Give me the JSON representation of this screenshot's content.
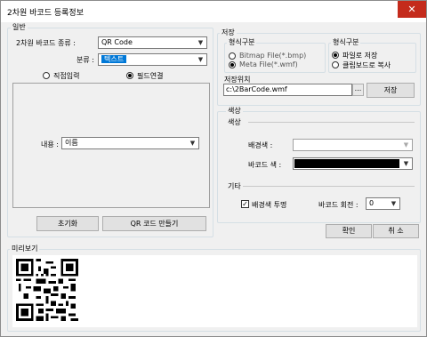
{
  "window": {
    "title": "2차원 바코드 등록정보",
    "close_glyph": "✕"
  },
  "general": {
    "group_label": "일반",
    "type_label": "2차원 바코드 종류 :",
    "type_value": "QR Code",
    "category_label": "분류 :",
    "category_value": "텍스트",
    "radio_direct": "직접입력",
    "radio_field": "필드연결",
    "content_label": "내용 :",
    "content_value": "이름",
    "reset_button": "초기화",
    "make_button": "QR 코드 만들기"
  },
  "save": {
    "group_label": "저장",
    "format_label": "형식구분",
    "bmp_option": "Bitmap File(*.bmp)",
    "wmf_option": "Meta File(*.wmf)",
    "target_label": "형식구분",
    "file_option": "파일로 저장",
    "clipboard_option": "클립보드로 복사",
    "location_label": "저장위치",
    "location_value": "c:\\2BarCode.wmf",
    "browse_glyph": "...",
    "save_button": "저장"
  },
  "color": {
    "group_label": "색상",
    "sub_label": "색상",
    "bg_label": "배경색 :",
    "bar_label": "바코드 색 :",
    "bg_color": "#ffffff",
    "bar_color": "#000000"
  },
  "etc": {
    "label": "기타",
    "transparent_label": "배경색 투명",
    "rotate_label": "바코드 회전 :",
    "rotate_value": "0"
  },
  "actions": {
    "ok_button": "확인",
    "cancel_button": "취 소"
  },
  "preview": {
    "label": "미리보기"
  }
}
